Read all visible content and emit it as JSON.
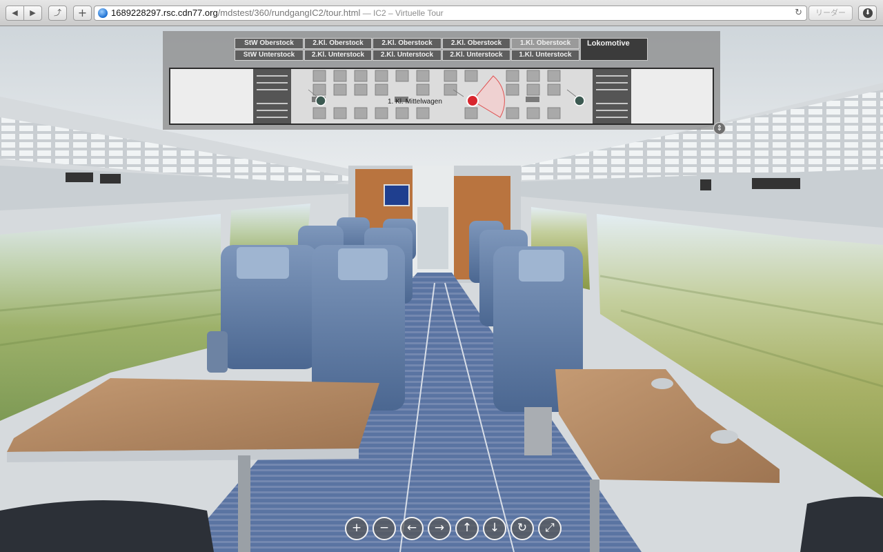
{
  "browser": {
    "back_glyph": "◀",
    "forward_glyph": "▶",
    "share_glyph": "⤴",
    "newtab_glyph": "+",
    "url_host": "1689228297.rsc.cdn77.org",
    "url_path": "/mdstest/360/rundgangIC2/tour.html",
    "page_title": " — IC2 – Virtuelle Tour",
    "reload_glyph": "↻",
    "reader_label": "リーダー",
    "download_glyph": "⬇"
  },
  "map": {
    "upper_deck": [
      "StW Oberstock",
      "2.Kl. Oberstock",
      "2.Kl. Oberstock",
      "2.Kl. Oberstock",
      "1.Kl. Oberstock"
    ],
    "lower_deck": [
      "StW Unterstock",
      "2.Kl. Unterstock",
      "2.Kl. Unterstock",
      "2.Kl. Unterstock",
      "1.Kl. Unterstock"
    ],
    "locomotive": "Lokomotive",
    "active_car": "1.Kl. Oberstock",
    "plan_label": "1. Kl. Mittelwagen",
    "collapse_glyph": "⇕"
  },
  "controls": {
    "zoom_in": "+",
    "zoom_out": "−",
    "left": "←",
    "right": "→",
    "up": "↑",
    "down": "↓",
    "auto_rotate": "↻",
    "fullscreen": "⤢"
  },
  "colors": {
    "hotspot_active": "#d8262e",
    "hotspot": "#3c5a52",
    "seat_blue": "#5f7fa6",
    "table_wood": "#b38a63",
    "carpet": "#5a76a3"
  }
}
